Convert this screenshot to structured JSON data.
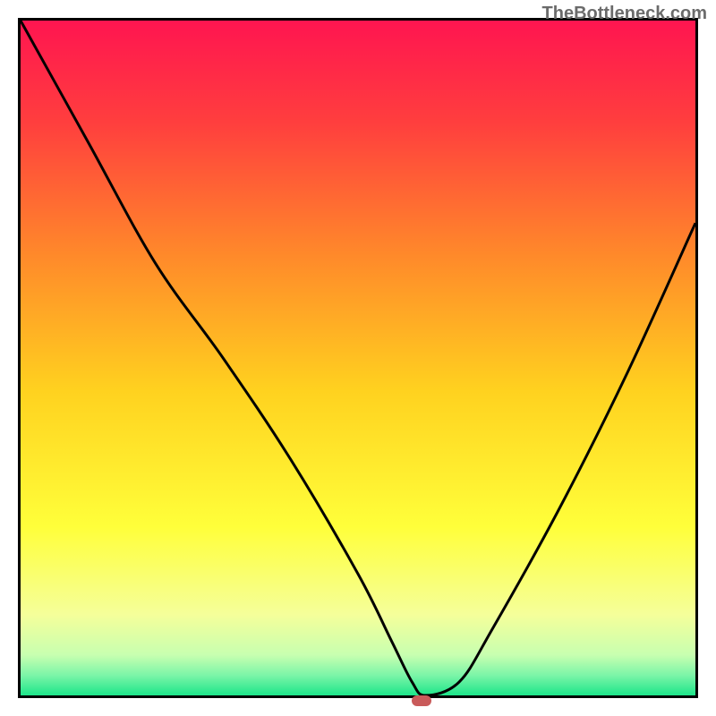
{
  "watermark": "TheBottleneck.com",
  "chart_data": {
    "type": "line",
    "title": "",
    "xlabel": "",
    "ylabel": "",
    "xlim": [
      0,
      100
    ],
    "ylim": [
      0,
      100
    ],
    "grid": false,
    "series": [
      {
        "name": "curve",
        "x": [
          0,
          10,
          20,
          30,
          40,
          50,
          55,
          58,
          60,
          65,
          70,
          80,
          90,
          100
        ],
        "y": [
          100,
          82,
          64,
          50,
          35,
          18,
          8,
          2,
          0,
          2,
          10,
          28,
          48,
          70
        ]
      }
    ],
    "marker": {
      "x": 59,
      "y": 0,
      "color": "#c95a5a"
    },
    "gradient_stops": [
      {
        "offset": 0.0,
        "color": "#ff1550"
      },
      {
        "offset": 0.15,
        "color": "#ff3e3e"
      },
      {
        "offset": 0.35,
        "color": "#ff8a2a"
      },
      {
        "offset": 0.55,
        "color": "#ffd21f"
      },
      {
        "offset": 0.75,
        "color": "#ffff3a"
      },
      {
        "offset": 0.88,
        "color": "#f5ff9a"
      },
      {
        "offset": 0.94,
        "color": "#c8ffb0"
      },
      {
        "offset": 0.97,
        "color": "#7cf5a8"
      },
      {
        "offset": 1.0,
        "color": "#1de58a"
      }
    ]
  }
}
